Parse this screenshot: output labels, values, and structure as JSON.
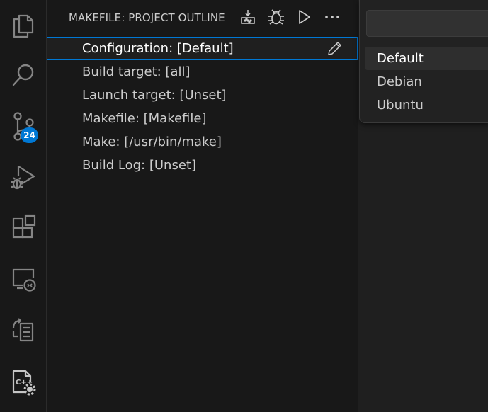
{
  "panel": {
    "title": "MAKEFILE: PROJECT OUTLINE",
    "header_actions": [
      "build-icon",
      "debug-icon",
      "run-icon",
      "more-icon"
    ]
  },
  "outline": {
    "items": [
      {
        "label": "Configuration: [Default]",
        "selected": true
      },
      {
        "label": "Build target: [all]"
      },
      {
        "label": "Launch target: [Unset]"
      },
      {
        "label": "Makefile: [Makefile]"
      },
      {
        "label": "Make: [/usr/bin/make]"
      },
      {
        "label": "Build Log: [Unset]"
      }
    ]
  },
  "activity_bar": {
    "items": [
      "explorer-icon",
      "search-icon",
      "source-control-icon",
      "run-debug-icon",
      "extensions-icon",
      "remote-explorer-icon",
      "makefile-tools-icon",
      "cpp-settings-icon"
    ],
    "scm_badge": "24"
  },
  "quick_pick": {
    "input_value": "",
    "options": [
      "Default",
      "Debian",
      "Ubuntu"
    ],
    "active_index": 0
  },
  "colors": {
    "accent": "#0078d4",
    "background": "#181818",
    "text": "#cccccc"
  }
}
